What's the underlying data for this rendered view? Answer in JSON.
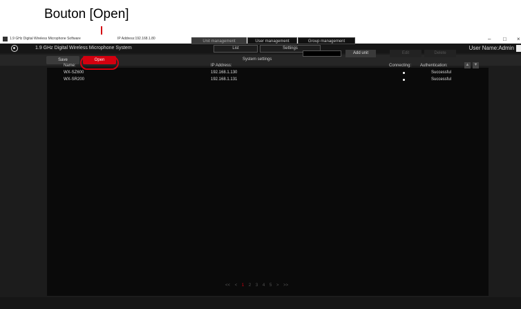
{
  "annotation": {
    "label": "Bouton [Open]"
  },
  "window": {
    "title": "1.9 GHz Digital Wireless Microphone Software",
    "ip_address": "IP Address:192.168.1.80",
    "minimize": "–",
    "maximize": "□",
    "close": "×"
  },
  "menubar": {
    "system_name": "1.9 GHz Digital Wireless Microphone System",
    "list_label": "List",
    "settings_label": "Settings",
    "user_name": "User Name:Admin"
  },
  "toolbar": {
    "save_label": "Save",
    "open_label": "Open",
    "title": "System settings"
  },
  "tabs": [
    {
      "label": "Unit management",
      "active": true
    },
    {
      "label": "User management",
      "active": false
    },
    {
      "label": "Group management",
      "active": false
    }
  ],
  "actions": {
    "search_value": "",
    "add_unit": "Add unit",
    "edit": "Edit",
    "delete": "Delete"
  },
  "table": {
    "headers": {
      "name": "Name:",
      "ip": "IP Address:",
      "connecting": "Connecting:",
      "authentication": "Authentication:"
    },
    "rows": [
      {
        "name": "WX-SZ600",
        "ip": "192.168.1.130",
        "connecting": "connected",
        "authentication": "Successful"
      },
      {
        "name": "WX-SR200",
        "ip": "192.168.1.131",
        "connecting": "connected",
        "authentication": "Successful"
      }
    ],
    "sort_up": "▲",
    "sort_down": "▼"
  },
  "pager": {
    "first": "<<",
    "prev": "<",
    "pages": [
      "1",
      "2",
      "3",
      "4",
      "5"
    ],
    "current": "1",
    "next": ">",
    "last": ">>"
  },
  "colors": {
    "accent": "#d4000f",
    "background": "#1c1c1c",
    "panel": "#0a0a0a"
  }
}
